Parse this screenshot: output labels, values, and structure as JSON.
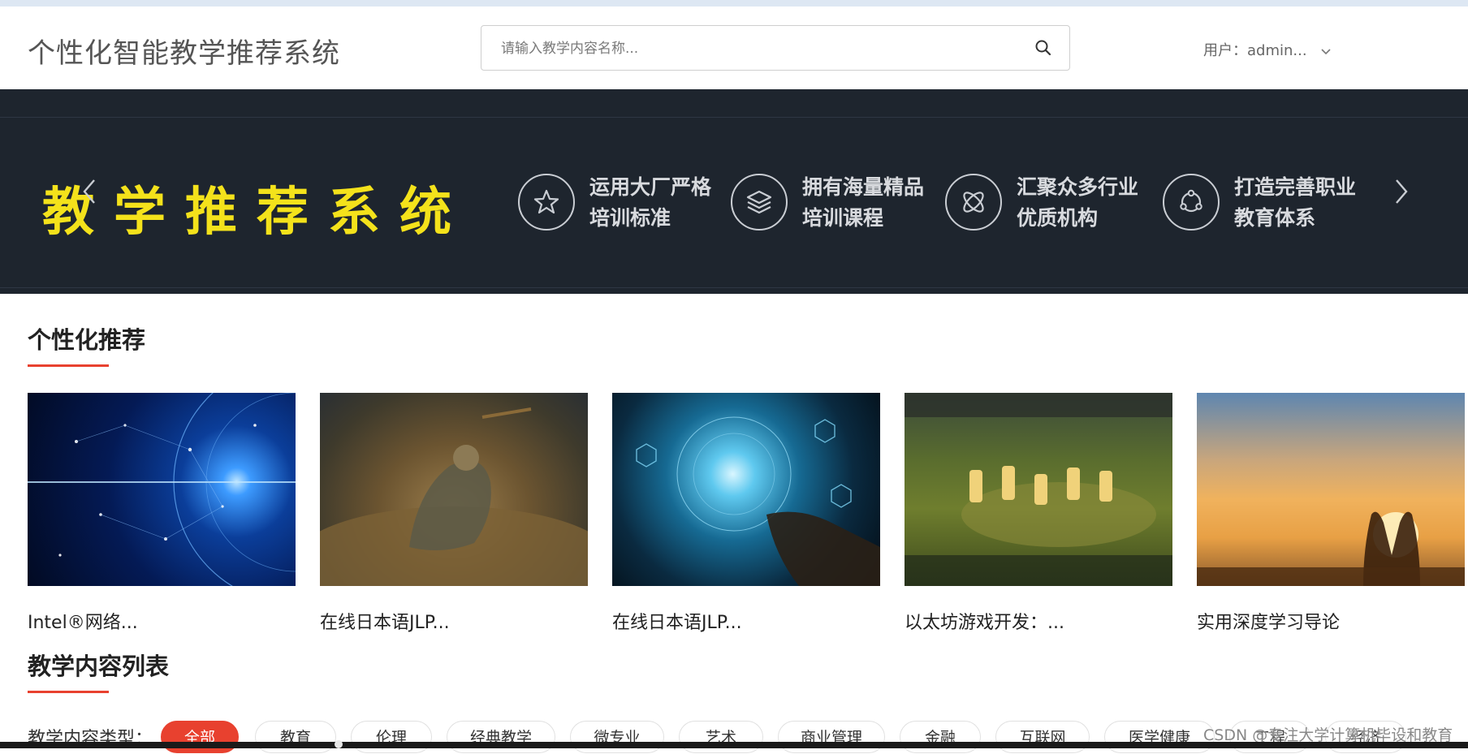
{
  "header": {
    "site_title": "个性化智能教学推荐系统",
    "search_placeholder": "请输入教学内容名称...",
    "user_label": "用户：",
    "user_name": "admin..."
  },
  "banner": {
    "title": "教学推荐系统",
    "features": [
      {
        "line1": "运用大厂严格",
        "line2": "培训标准",
        "icon": "star-icon"
      },
      {
        "line1": "拥有海量精品",
        "line2": "培训课程",
        "icon": "layers-icon"
      },
      {
        "line1": "汇聚众多行业",
        "line2": "优质机构",
        "icon": "atom-icon"
      },
      {
        "line1": "打造完善职业",
        "line2": "教育体系",
        "icon": "network-icon"
      }
    ]
  },
  "recommend": {
    "title": "个性化推荐",
    "items": [
      {
        "name": "Intel®网络..."
      },
      {
        "name": "在线日本语JLP..."
      },
      {
        "name": "在线日本语JLP..."
      },
      {
        "name": "以太坊游戏开发：..."
      },
      {
        "name": "实用深度学习导论"
      }
    ]
  },
  "content_list": {
    "title": "教学内容列表",
    "filter_label": "教学内容类型：",
    "categories": [
      "全部",
      "教育",
      "伦理",
      "经典教学",
      "微专业",
      "艺术",
      "商业管理",
      "金融",
      "互联网",
      "医学健康",
      "工程",
      "经济"
    ],
    "active_index": 0
  },
  "watermark": "CSDN @专注大学计算机毕设和教育",
  "colors": {
    "accent": "#e8412f",
    "banner_bg": "#1e252e",
    "banner_title": "#f4e21b"
  }
}
